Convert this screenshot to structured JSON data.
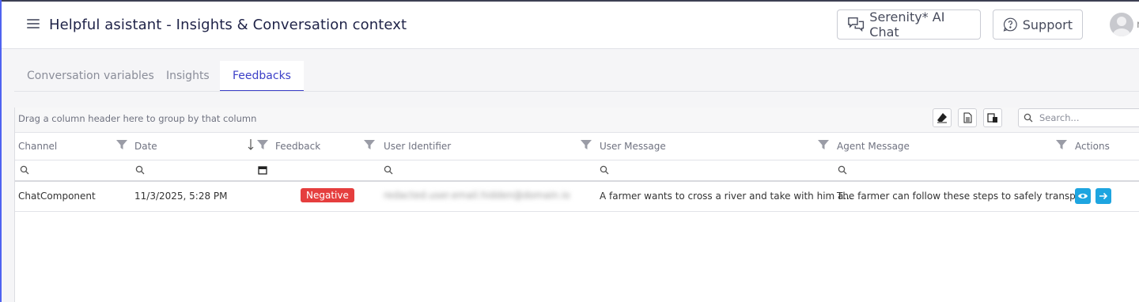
{
  "header": {
    "title": "Helpful asistant - Insights & Conversation context",
    "chat_button": "Serenity* AI Chat",
    "support_button": "Support",
    "user_initial": "r"
  },
  "tabs": [
    {
      "label": "Conversation variables",
      "active": false
    },
    {
      "label": "Insights",
      "active": false
    },
    {
      "label": "Feedbacks",
      "active": true
    }
  ],
  "grid": {
    "group_panel_text": "Drag a column header here to group by that column",
    "search_placeholder": "Search...",
    "columns": [
      "Channel",
      "Date",
      "Feedback",
      "User Identifier",
      "User Message",
      "Agent Message",
      "Actions"
    ],
    "rows": [
      {
        "channel": "ChatComponent",
        "date": "11/3/2025, 5:28 PM",
        "feedback": "Negative",
        "user_identifier": "redacted.user.email.hidden@domain.io",
        "user_message": "A farmer wants to cross a river and take with him a...",
        "agent_message": "The farmer can follow these steps to safely transp..."
      }
    ]
  },
  "colors": {
    "accent": "#3b3fc7",
    "negative": "#e53e3e",
    "action": "#1ea5e0"
  }
}
